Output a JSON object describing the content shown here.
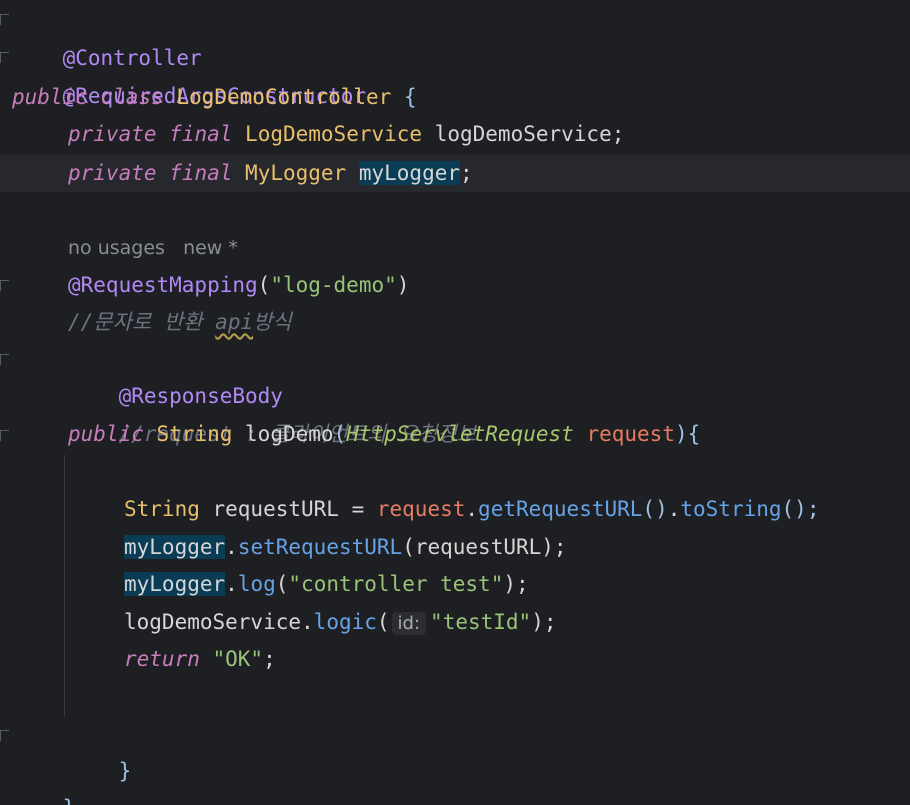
{
  "annotations": {
    "controller": "@Controller",
    "required_args": "@RequiredArgsConstructor",
    "request_mapping": "@RequestMapping",
    "response_body": "@ResponseBody"
  },
  "keywords": {
    "public": "public",
    "class": "class",
    "private": "private",
    "final": "final",
    "return": "return"
  },
  "class_decl": {
    "name": "LogDemoController",
    "open_brace": "{"
  },
  "fields": [
    {
      "type": "LogDemoService",
      "name": "logDemoService",
      "end": ";"
    },
    {
      "type": "MyLogger",
      "name": "myLogger",
      "end": ";"
    }
  ],
  "usage_hint": {
    "usages": "no usages",
    "status": "new *"
  },
  "mapping": {
    "open": "(",
    "path": "\"log-demo\"",
    "close": ")"
  },
  "comments": {
    "c1_prefix": "//문자로 반환 ",
    "c1_squiggle": "api",
    "c1_suffix": "방식",
    "c2": "//request : 클라이언트의 요청정보"
  },
  "method_decl": {
    "return_type": "String",
    "name": "logDemo",
    "open": "(",
    "param_type": "HttpServletRequest",
    "param_name": "request",
    "close": ")",
    "brace": "{"
  },
  "body": {
    "l1_type": "String",
    "l1_var": " requestURL = ",
    "l1_obj": "request",
    "l1_dot": ".",
    "l1_m1": "getRequestURL",
    "l1_p1": "()",
    "l1_dot2": ".",
    "l1_m2": "toString",
    "l1_end": "();",
    "l2_obj": "myLogger",
    "l2_dot": ".",
    "l2_m": "setRequestURL",
    "l2_open": "(",
    "l2_arg": "requestURL",
    "l2_end": ");",
    "l3_obj": "myLogger",
    "l3_dot": ".",
    "l3_m": "log",
    "l3_open": "(",
    "l3_arg": "\"controller test\"",
    "l3_end": ");",
    "l4_obj": "logDemoService",
    "l4_dot": ".",
    "l4_m": "logic",
    "l4_open": "(",
    "l4_hint": "id:",
    "l4_arg": "\"testId\"",
    "l4_end": ");",
    "l5_ret": "return",
    "l5_val": " \"OK\"",
    "l5_end": ";"
  },
  "closers": {
    "method": "}",
    "class": "}"
  }
}
